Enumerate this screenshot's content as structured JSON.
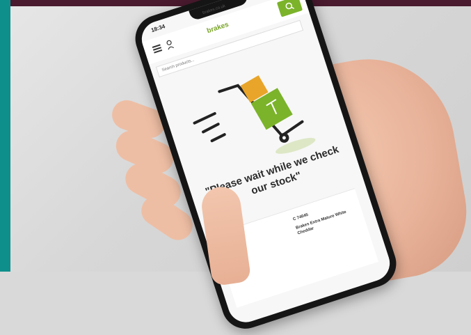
{
  "status_bar": {
    "time": "18:34",
    "url": "brakes.co.uk",
    "icons": "▮▮ ◔ ▭"
  },
  "header": {
    "logo_text": "brakes",
    "search_icon": "search-icon"
  },
  "search": {
    "placeholder": "Search products..."
  },
  "message": "\"Please wait while we check our stock\"",
  "product": {
    "code": "C 74045",
    "name": "Brakes Extra Mature White Cheddar"
  },
  "colors": {
    "brand_green": "#7bb32a",
    "teal": "#0f8f8c",
    "top_bar": "#4a1a2e"
  }
}
